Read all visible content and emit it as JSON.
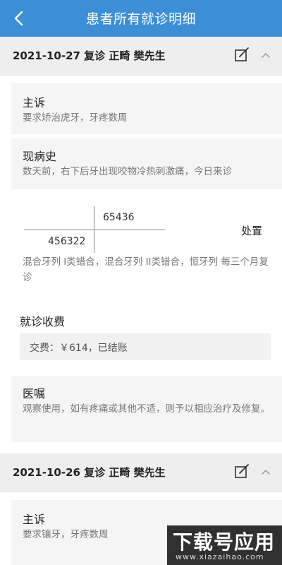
{
  "header": {
    "title": "患者所有就诊明细",
    "back_icon": "chevron-left-icon"
  },
  "visits": [
    {
      "title": "2021-10-27 复诊 正畸 樊先生",
      "chief_complaint": {
        "label": "主诉",
        "text": "要求矫治虎牙，牙疼数周"
      },
      "present_illness": {
        "label": "现病史",
        "text": "数天前，右下后牙出现咬物冷热刺激痛，今日来诊"
      },
      "tooth_chart": {
        "upper_right": "65436",
        "lower_left": "456322",
        "action_label": "处置",
        "diagnosis": "混合牙列 I类错合，混合牙列 II类错合，恒牙列 每三个月复诊"
      },
      "fee": {
        "label": "就诊收费",
        "text": "交费：￥614，已结账"
      },
      "advice": {
        "label": "医嘱",
        "text": "观察使用，如有疼痛或其他不适，则予以相应治疗及修复。"
      }
    },
    {
      "title": "2021-10-26 复诊 正畸 樊先生",
      "chief_complaint": {
        "label": "主诉",
        "text": "要求镶牙，牙疼数周"
      }
    }
  ],
  "watermark": {
    "main": "下载号应用",
    "sub": "www.xiazaihao.com"
  },
  "colors": {
    "header_bg": "#3c8fd6",
    "section_bg": "#f5f5f5",
    "bar_bg": "#eeeeee"
  }
}
